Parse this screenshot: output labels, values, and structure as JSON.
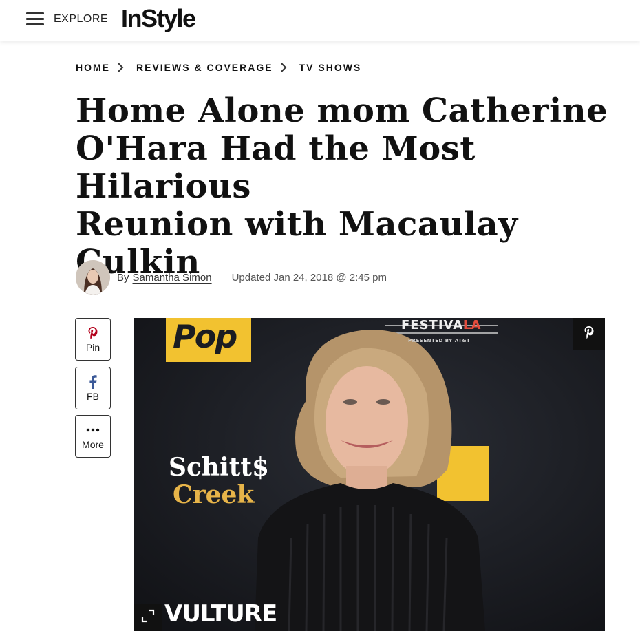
{
  "header": {
    "menu_icon": "hamburger-icon",
    "explore_label": "EXPLORE",
    "logo_text": "InStyle"
  },
  "breadcrumb": [
    "HOME",
    "REVIEWS & COVERAGE",
    "TV SHOWS"
  ],
  "article": {
    "headline_lines": [
      "Home Alone mom Catherine",
      "O'Hara Had the Most Hilarious",
      "Reunion with Macaulay",
      "Culkin"
    ],
    "by_label": "By",
    "author": "Samantha Simon",
    "updated": "Updated Jan 24, 2018 @ 2:45 pm"
  },
  "share": [
    {
      "label": "Pin",
      "icon": "pinterest-icon",
      "color": "#b3001b"
    },
    {
      "label": "FB",
      "icon": "facebook-icon",
      "color": "#3b5998"
    },
    {
      "label": "More",
      "icon": "more-dots-icon",
      "color": "#111111"
    }
  ],
  "hero": {
    "sign_pop": "Pop",
    "sign_festival": "FESTIVAL",
    "sign_la": "LA",
    "sign_presented": "PRESENTED BY AT&T",
    "sign_schitts": "Schitt$",
    "sign_creek": "Creek",
    "sign_vulture": "VULTURE",
    "pin_icon": "pinterest-icon",
    "expand_icon": "expand-icon"
  },
  "colors": {
    "pop_yellow": "#f2c230",
    "backdrop": "#1b1d22",
    "text": "#111111"
  }
}
